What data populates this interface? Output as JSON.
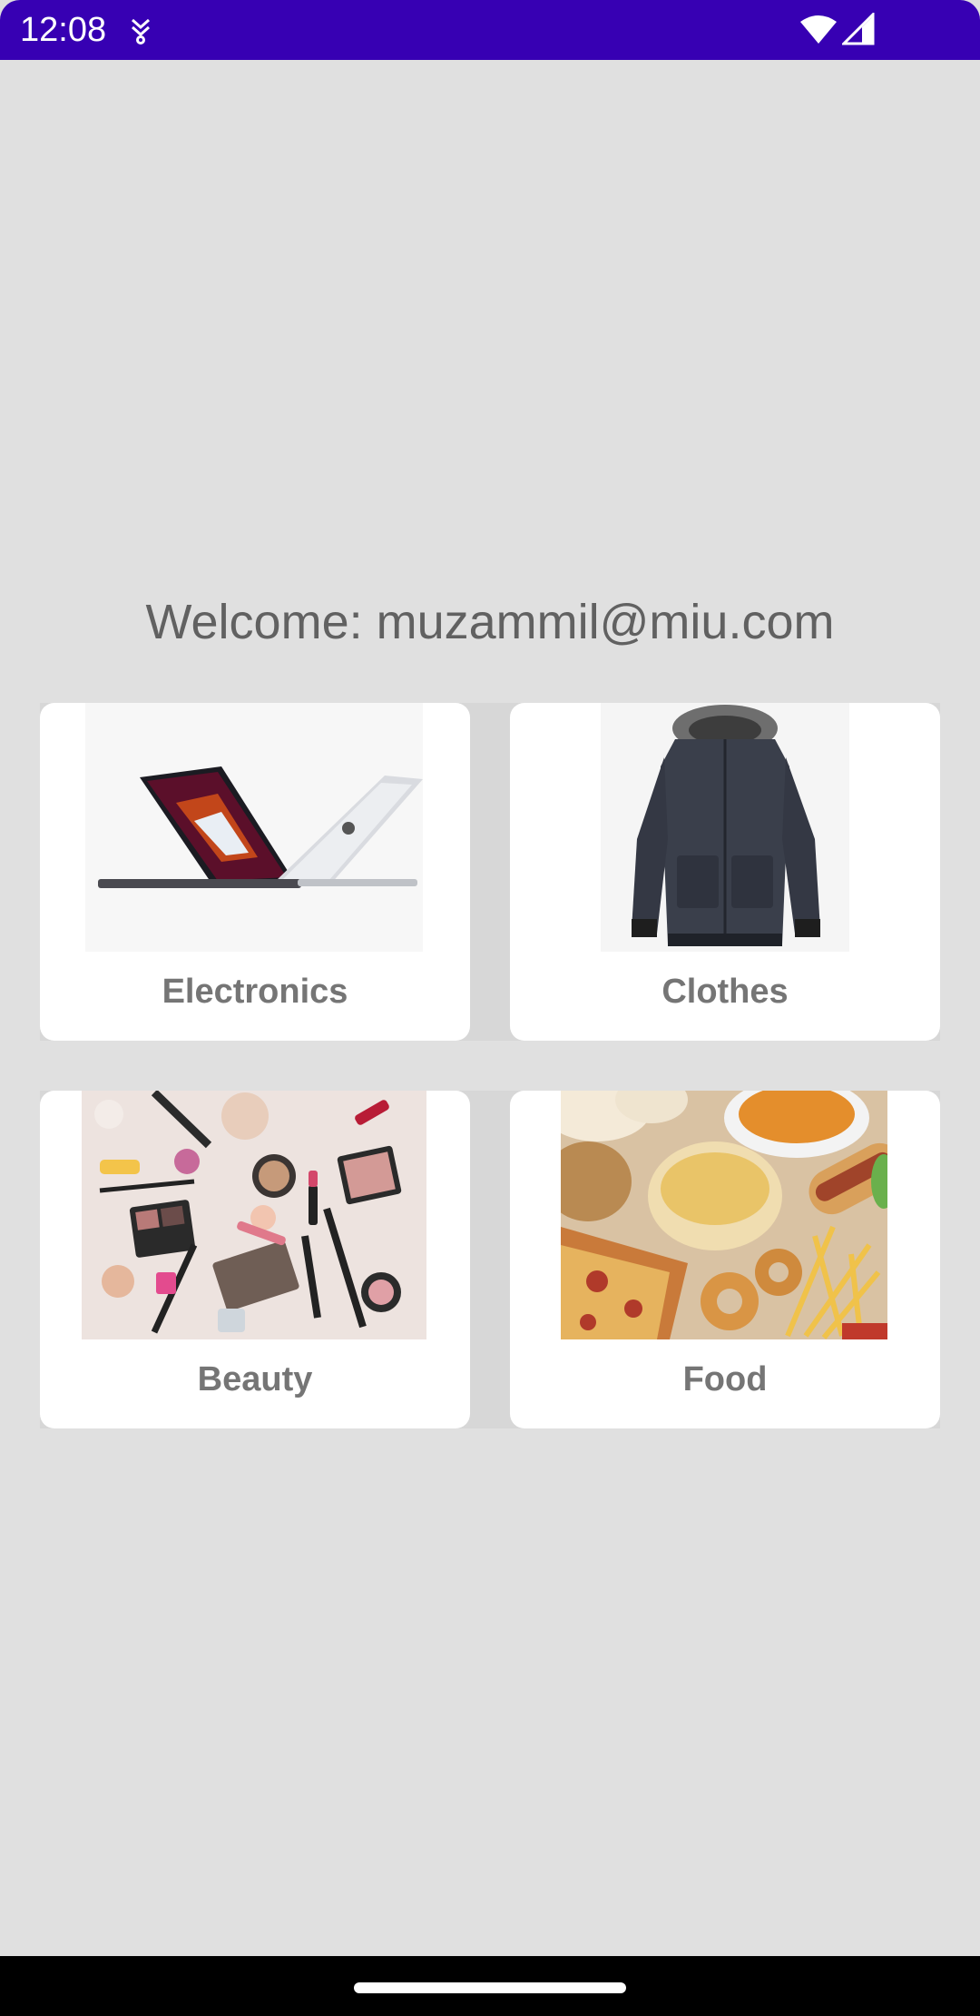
{
  "status_bar": {
    "time": "12:08",
    "notification_icon": "download-arrow-icon",
    "wifi_icon": "wifi-icon",
    "signal_icon": "cell-signal-icon",
    "color": "#3700b3"
  },
  "welcome": {
    "text": "Welcome: muzammil@miu.com"
  },
  "categories": [
    {
      "label": "Electronics",
      "image": "laptop-image"
    },
    {
      "label": "Clothes",
      "image": "jacket-image"
    },
    {
      "label": "Beauty",
      "image": "cosmetics-image"
    },
    {
      "label": "Food",
      "image": "snacks-food-image"
    }
  ],
  "colors": {
    "background": "#e0e0e0",
    "card": "#ffffff",
    "label": "#757575",
    "welcome_text": "#616161"
  }
}
